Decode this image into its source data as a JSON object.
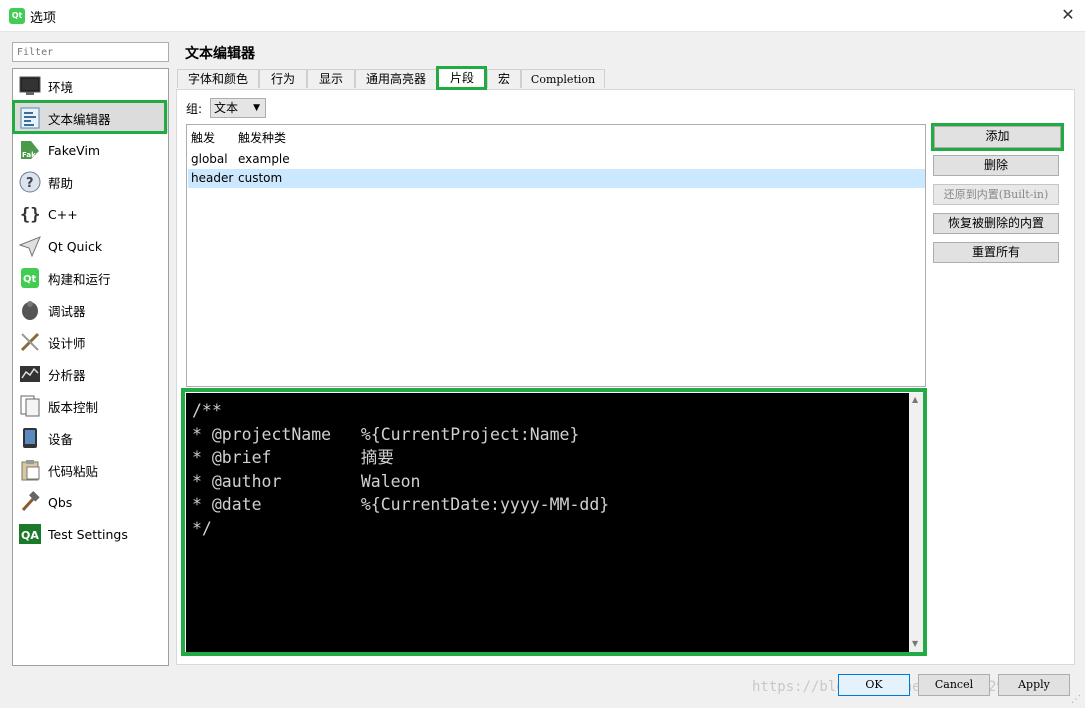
{
  "window": {
    "title": "选项",
    "app_icon_text": "Qt",
    "close": "✕"
  },
  "filter": {
    "placeholder": "Filter"
  },
  "sidebar": {
    "items": [
      {
        "label": "环境",
        "icon": "monitor-icon"
      },
      {
        "label": "文本编辑器",
        "icon": "text-editor-icon"
      },
      {
        "label": "FakeVim",
        "icon": "fakevim-icon"
      },
      {
        "label": "帮助",
        "icon": "help-icon"
      },
      {
        "label": "C++",
        "icon": "braces-icon"
      },
      {
        "label": "Qt Quick",
        "icon": "paper-plane-icon"
      },
      {
        "label": "构建和运行",
        "icon": "build-run-icon"
      },
      {
        "label": "调试器",
        "icon": "debugger-icon"
      },
      {
        "label": "设计师",
        "icon": "designer-icon"
      },
      {
        "label": "分析器",
        "icon": "analyzer-icon"
      },
      {
        "label": "版本控制",
        "icon": "version-control-icon"
      },
      {
        "label": "设备",
        "icon": "device-icon"
      },
      {
        "label": "代码粘贴",
        "icon": "code-paste-icon"
      },
      {
        "label": "Qbs",
        "icon": "hammer-icon"
      },
      {
        "label": "Test Settings",
        "icon": "qa-icon"
      }
    ],
    "selected": "文本编辑器"
  },
  "section_title": "文本编辑器",
  "tabs": [
    "字体和颜色",
    "行为",
    "显示",
    "通用高亮器",
    "片段",
    "宏",
    "Completion"
  ],
  "active_tab": "片段",
  "group": {
    "label": "组:",
    "value": "文本"
  },
  "snippets_table": {
    "columns": [
      "触发",
      "触发种类"
    ],
    "rows": [
      [
        "global",
        "example"
      ],
      [
        "header",
        "custom"
      ]
    ],
    "selected_row": 1
  },
  "side_buttons": {
    "add": "添加",
    "remove": "删除",
    "revert_builtin": "还原到内置(Built-in)",
    "restore_removed": "恢复被删除的内置",
    "reset_all": "重置所有"
  },
  "editor": {
    "lines": [
      "/**",
      "* @projectName   %{CurrentProject:Name}",
      "* @brief         摘要",
      "* @author        Waleon",
      "* @date          %{CurrentDate:yyyy-MM-dd}",
      "*/"
    ]
  },
  "dialog_buttons": {
    "ok": "OK",
    "cancel": "Cancel",
    "apply": "Apply"
  },
  "watermark": "https://blog.csdn.net/u011012932",
  "colors": {
    "highlight": "#22aa44",
    "selection": "#cce8ff",
    "editor_bg": "#000000"
  }
}
